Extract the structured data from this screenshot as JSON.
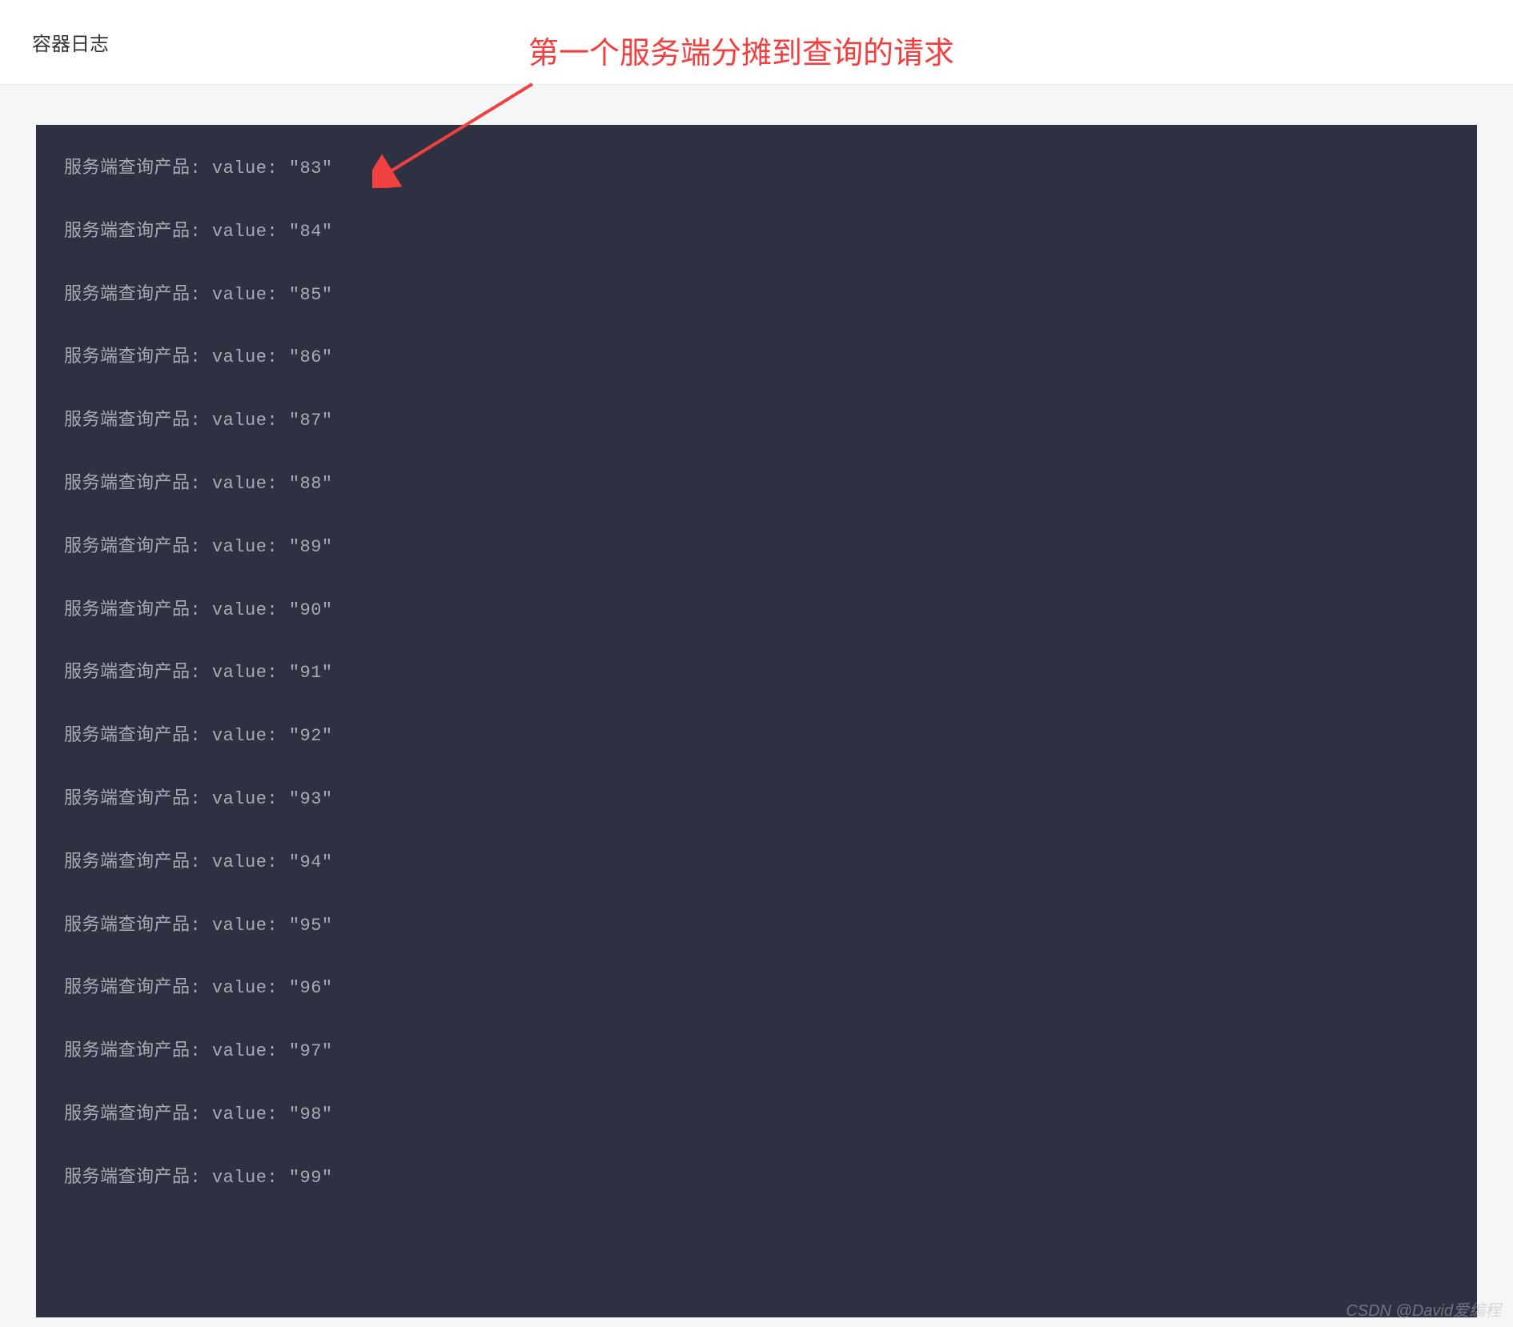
{
  "header": {
    "title": "容器日志"
  },
  "annotation": {
    "text": "第一个服务端分摊到查询的请求"
  },
  "logs": {
    "prefix": "服务端查询产品:",
    "value_label": "value:",
    "lines": [
      {
        "text": "服务端查询产品: value: \"83\""
      },
      {
        "text": "服务端查询产品: value: \"84\""
      },
      {
        "text": "服务端查询产品: value: \"85\""
      },
      {
        "text": "服务端查询产品: value: \"86\""
      },
      {
        "text": "服务端查询产品: value: \"87\""
      },
      {
        "text": "服务端查询产品: value: \"88\""
      },
      {
        "text": "服务端查询产品: value: \"89\""
      },
      {
        "text": "服务端查询产品: value: \"90\""
      },
      {
        "text": "服务端查询产品: value: \"91\""
      },
      {
        "text": "服务端查询产品: value: \"92\""
      },
      {
        "text": "服务端查询产品: value: \"93\""
      },
      {
        "text": "服务端查询产品: value: \"94\""
      },
      {
        "text": "服务端查询产品: value: \"95\""
      },
      {
        "text": "服务端查询产品: value: \"96\""
      },
      {
        "text": "服务端查询产品: value: \"97\""
      },
      {
        "text": "服务端查询产品: value: \"98\""
      },
      {
        "text": "服务端查询产品: value: \"99\""
      }
    ]
  },
  "watermark": {
    "text": "CSDN @David爱编程"
  }
}
